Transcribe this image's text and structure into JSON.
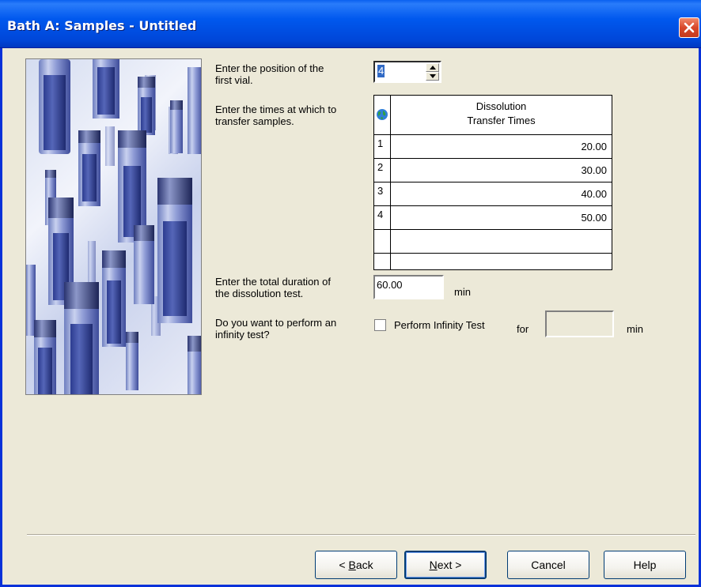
{
  "window": {
    "title": "Bath A: Samples - Untitled"
  },
  "prompts": {
    "first_vial_line1": "Enter the position of the",
    "first_vial_line2": "first vial.",
    "times_line1": "Enter the times at which to",
    "times_line2": "transfer samples.",
    "duration_line1": "Enter the total duration of",
    "duration_line2": "the dissolution test.",
    "infinity_line1": "Do you want to perform an",
    "infinity_line2": "infinity test?"
  },
  "first_vial": {
    "value": "4"
  },
  "transfer_grid": {
    "header_line1": "Dissolution",
    "header_line2": "Transfer Times",
    "rows": [
      {
        "index": "1",
        "time": "20.00"
      },
      {
        "index": "2",
        "time": "30.00"
      },
      {
        "index": "3",
        "time": "40.00"
      },
      {
        "index": "4",
        "time": "50.00"
      },
      {
        "index": "",
        "time": ""
      },
      {
        "index": "",
        "time": ""
      }
    ]
  },
  "duration": {
    "value": "60.00",
    "unit": "min"
  },
  "infinity": {
    "checkbox_label": "Perform Infinity Test",
    "checked": false,
    "for_label": "for",
    "value": "",
    "unit": "min"
  },
  "buttons": {
    "back_prefix": "< ",
    "back_mnemonic": "B",
    "back_rest": "ack",
    "next_mnemonic": "N",
    "next_rest": "ext >",
    "cancel": "Cancel",
    "help": "Help"
  },
  "colors": {
    "titlebar": "#0058ee",
    "window_bg": "#ece9d8",
    "selection": "#316ac5",
    "close": "#d8482a"
  },
  "icons": {
    "grid_corner": "globe-icon",
    "close": "close-icon"
  }
}
